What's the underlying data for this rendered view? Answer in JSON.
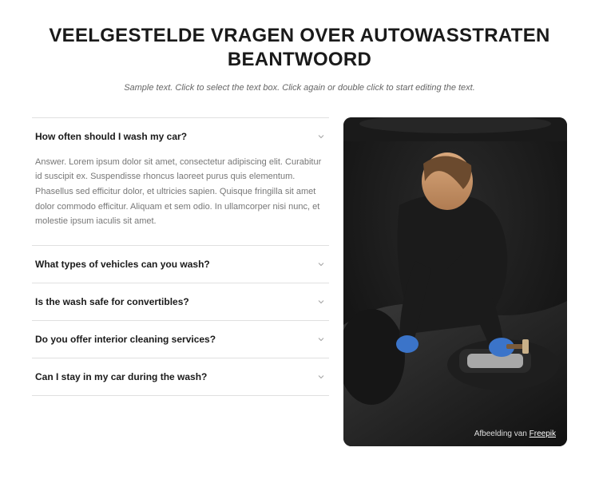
{
  "header": {
    "title": "VEELGESTELDE VRAGEN OVER AUTOWASSTRATEN BEANTWOORD",
    "subtitle": "Sample text. Click to select the text box. Click again or double click to start editing the text."
  },
  "faq": {
    "items": [
      {
        "question": "How often should I wash my car?",
        "expanded": true,
        "answer": "Answer. Lorem ipsum dolor sit amet, consectetur adipiscing elit. Curabitur id suscipit ex. Suspendisse rhoncus laoreet purus quis elementum. Phasellus sed efficitur dolor, et ultricies sapien. Quisque fringilla sit amet dolor commodo efficitur. Aliquam et sem odio. In ullamcorper nisi nunc, et molestie ipsum iaculis sit amet."
      },
      {
        "question": "What types of vehicles can you wash?",
        "expanded": false
      },
      {
        "question": "Is the wash safe for convertibles?",
        "expanded": false
      },
      {
        "question": "Do you offer interior cleaning services?",
        "expanded": false
      },
      {
        "question": "Can I stay in my car during the wash?",
        "expanded": false
      }
    ]
  },
  "image": {
    "caption_prefix": "Afbeelding van ",
    "caption_link": "Freepik"
  }
}
